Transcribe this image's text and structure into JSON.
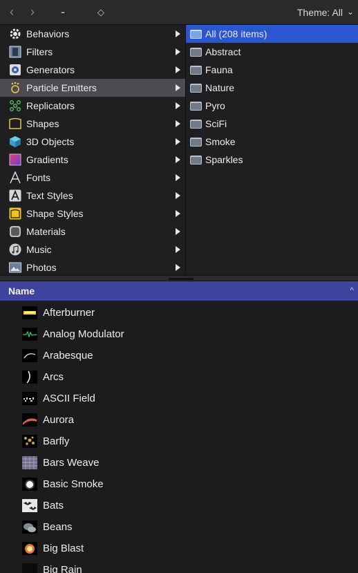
{
  "topbar": {
    "back": "‹",
    "forward": "›",
    "dash": "-",
    "updown": "◇",
    "theme_label": "Theme: All",
    "theme_chevron": "⌄"
  },
  "categories": [
    {
      "label": "Behaviors",
      "icon": "gear-icon"
    },
    {
      "label": "Filters",
      "icon": "filmstrip-icon"
    },
    {
      "label": "Generators",
      "icon": "generator-icon"
    },
    {
      "label": "Particle Emitters",
      "icon": "particle-emitter-icon",
      "selected": true
    },
    {
      "label": "Replicators",
      "icon": "replicator-icon"
    },
    {
      "label": "Shapes",
      "icon": "shape-icon"
    },
    {
      "label": "3D Objects",
      "icon": "cube-icon"
    },
    {
      "label": "Gradients",
      "icon": "gradient-icon"
    },
    {
      "label": "Fonts",
      "icon": "font-icon"
    },
    {
      "label": "Text Styles",
      "icon": "text-style-icon"
    },
    {
      "label": "Shape Styles",
      "icon": "shape-style-icon"
    },
    {
      "label": "Materials",
      "icon": "material-icon"
    },
    {
      "label": "Music",
      "icon": "music-icon"
    },
    {
      "label": "Photos",
      "icon": "photo-icon"
    }
  ],
  "themes": [
    {
      "label": "All (208 items)",
      "selected": true
    },
    {
      "label": "Abstract"
    },
    {
      "label": "Fauna"
    },
    {
      "label": "Nature"
    },
    {
      "label": "Pyro"
    },
    {
      "label": "SciFi"
    },
    {
      "label": "Smoke"
    },
    {
      "label": "Sparkles"
    }
  ],
  "list": {
    "header": "Name",
    "sort_indicator": "^",
    "items": [
      {
        "label": "Afterburner"
      },
      {
        "label": "Analog Modulator"
      },
      {
        "label": "Arabesque"
      },
      {
        "label": "Arcs"
      },
      {
        "label": "ASCII Field"
      },
      {
        "label": "Aurora"
      },
      {
        "label": "Barfly"
      },
      {
        "label": "Bars Weave"
      },
      {
        "label": "Basic Smoke"
      },
      {
        "label": "Bats"
      },
      {
        "label": "Beans"
      },
      {
        "label": "Big Blast"
      },
      {
        "label": "Big Rain"
      }
    ]
  },
  "colors": {
    "selected_theme": "#2c55d1",
    "selected_category": "#4c4c50",
    "list_header": "#3e449e"
  }
}
